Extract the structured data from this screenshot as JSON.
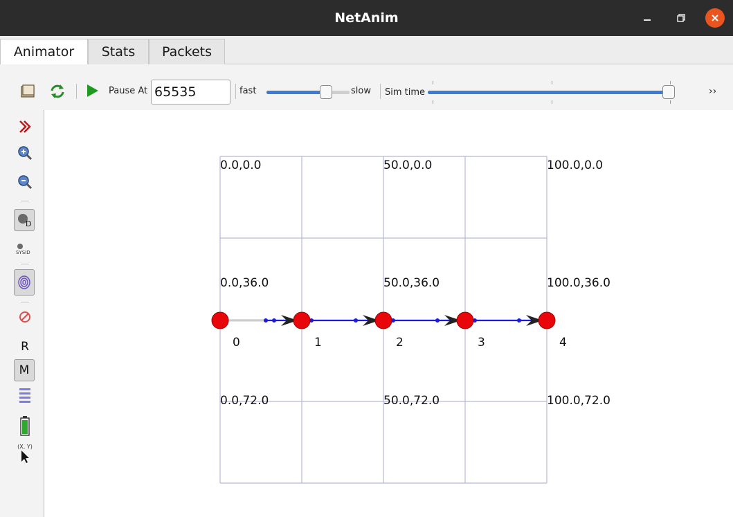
{
  "window": {
    "title": "NetAnim"
  },
  "tabs": [
    {
      "label": "Animator",
      "active": true
    },
    {
      "label": "Stats",
      "active": false
    },
    {
      "label": "Packets",
      "active": false
    }
  ],
  "toolbar": {
    "pause_at_label": "Pause At",
    "pause_at_value": "65535",
    "fast_label": "fast",
    "slow_label": "slow",
    "sim_time_label": "Sim time",
    "speed_fraction": 0.72,
    "sim_time_fraction": 1.0,
    "overflow_label": "››"
  },
  "left_tools": {
    "r_label": "R",
    "m_label": "M",
    "xy_label": "(X, Y)",
    "sysid_label": "SYSID",
    "d_label": "D"
  },
  "canvas": {
    "grid_labels": [
      "0.0,0.0",
      "50.0,0.0",
      "100.0,0.0",
      "0.0,36.0",
      "50.0,36.0",
      "100.0,36.0",
      "0.0,72.0",
      "50.0,72.0",
      "100.0,72.0"
    ],
    "nodes": [
      {
        "id": "0"
      },
      {
        "id": "1"
      },
      {
        "id": "2"
      },
      {
        "id": "3"
      },
      {
        "id": "4"
      }
    ]
  },
  "colors": {
    "titlebar": "#2c2c2c",
    "close_button": "#e9541f",
    "node_fill": "#e8060a",
    "link": "#1a1ae0",
    "grid": "#b8b8d8",
    "slider": "#3d7ad4"
  }
}
